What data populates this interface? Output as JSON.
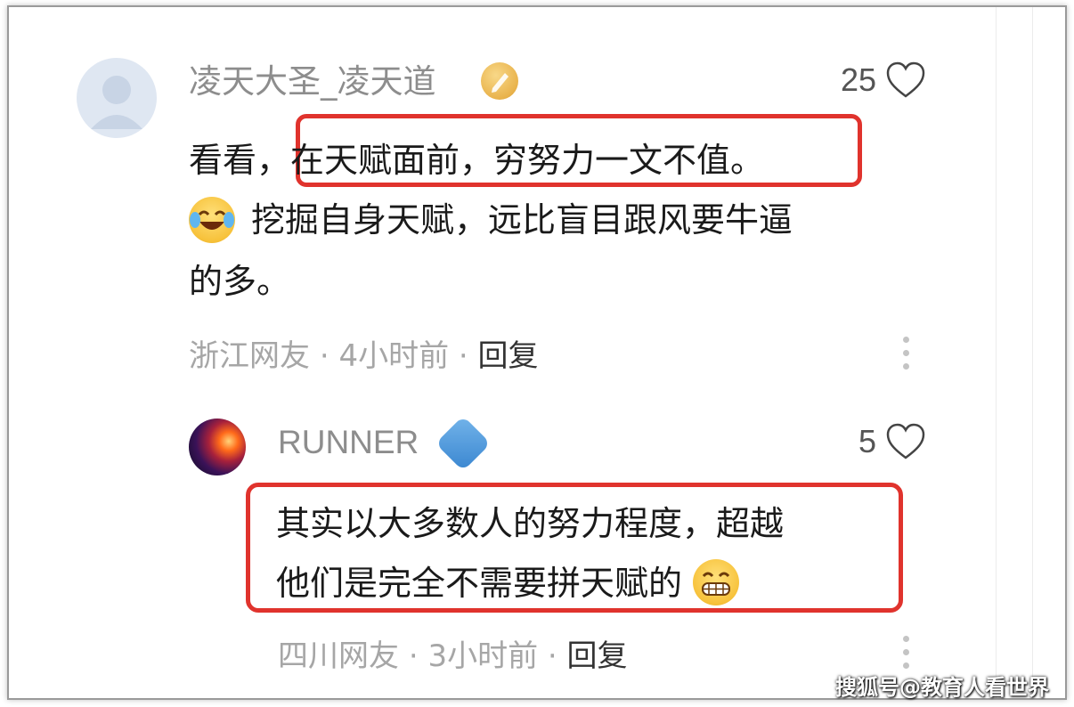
{
  "comment1": {
    "username": "凌天大圣_凌天道",
    "likes": "25",
    "text_line1_prefix": "看看，",
    "text_line1_highlight": "在天赋面前，穷努力一文不值。",
    "text_line2": "挖掘自身天赋，远比盲目跟风要牛逼",
    "text_line3": "的多。",
    "location": "浙江网友",
    "time": "4小时前",
    "reply_label": "回复",
    "separator": "·",
    "badge_icon": "pen-medal-icon",
    "emoji": "laugh-crying-emoji"
  },
  "comment2": {
    "username": "RUNNER",
    "likes": "5",
    "text_line1": "其实以大多数人的努力程度，超越",
    "text_line2": "他们是完全不需要拼天赋的",
    "location": "四川网友",
    "time": "3小时前",
    "reply_label": "回复",
    "separator": "·",
    "badge_icon": "level-badge-icon",
    "emoji": "grinning-emoji"
  },
  "watermark": "搜狐号@教育人看世界",
  "colors": {
    "highlight": "#e0332d",
    "username": "#8d8d8d",
    "meta": "#a6a6a6"
  }
}
